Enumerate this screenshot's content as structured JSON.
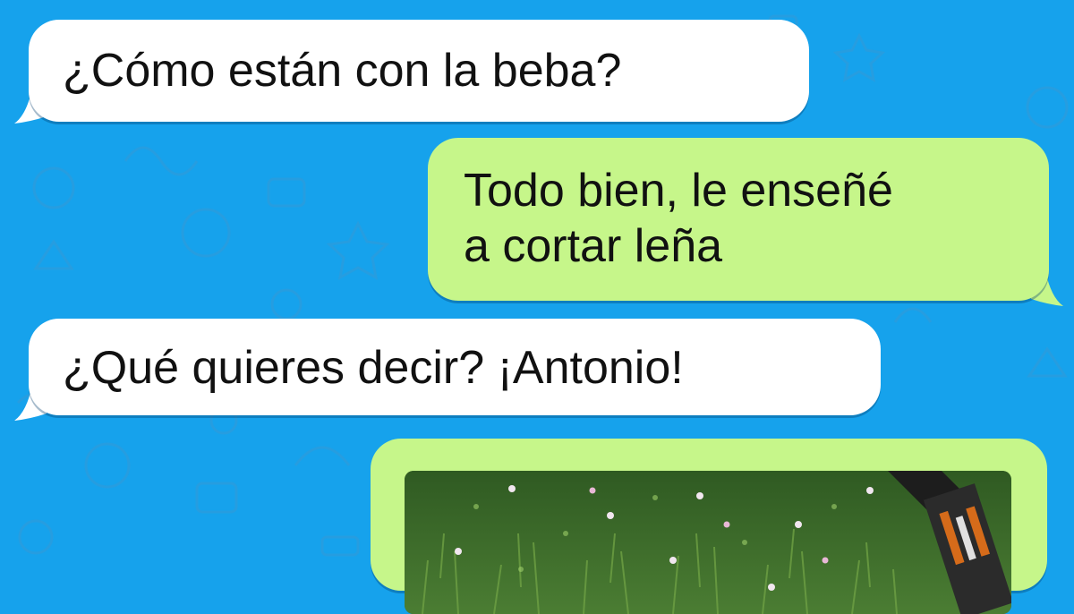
{
  "chat": {
    "background_color": "#16a2ec",
    "incoming_bubble_color": "#ffffff",
    "outgoing_bubble_color": "#c6f68a",
    "messages": [
      {
        "direction": "incoming",
        "text": "¿Cómo están con la beba?"
      },
      {
        "direction": "outgoing",
        "text": "Todo bien, le enseñé\na cortar leña"
      },
      {
        "direction": "incoming",
        "text": "¿Qué quieres decir? ¡Antonio!"
      },
      {
        "direction": "outgoing",
        "type": "image",
        "image_description": "grass-with-flowers-photo"
      }
    ]
  }
}
